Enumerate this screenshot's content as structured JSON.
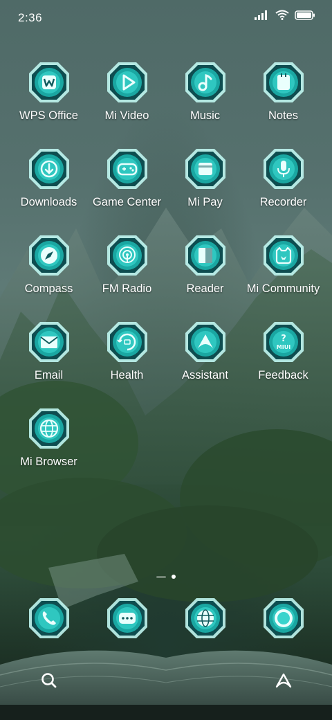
{
  "status_bar": {
    "time": "2:36",
    "icons": [
      "cellular-signal-icon",
      "wifi-icon",
      "battery-icon"
    ]
  },
  "apps": [
    {
      "label": "WPS Office",
      "icon": "wps-office-icon"
    },
    {
      "label": "Mi Video",
      "icon": "play-icon"
    },
    {
      "label": "Music",
      "icon": "music-note-icon"
    },
    {
      "label": "Notes",
      "icon": "notes-icon"
    },
    {
      "label": "Downloads",
      "icon": "download-icon"
    },
    {
      "label": "Game Center",
      "icon": "gamepad-icon"
    },
    {
      "label": "Mi Pay",
      "icon": "wallet-icon"
    },
    {
      "label": "Recorder",
      "icon": "microphone-icon"
    },
    {
      "label": "Compass",
      "icon": "compass-icon"
    },
    {
      "label": "FM Radio",
      "icon": "radio-icon"
    },
    {
      "label": "Reader",
      "icon": "book-icon"
    },
    {
      "label": "Mi Community",
      "icon": "community-icon"
    },
    {
      "label": "Email",
      "icon": "envelope-icon"
    },
    {
      "label": "Health",
      "icon": "health-icon"
    },
    {
      "label": "Assistant",
      "icon": "assistant-icon"
    },
    {
      "label": "Feedback",
      "icon": "feedback-icon",
      "badge_text": "MIUI"
    },
    {
      "label": "Mi Browser",
      "icon": "globe-icon"
    }
  ],
  "dock": [
    {
      "icon": "phone-icon"
    },
    {
      "icon": "messages-icon"
    },
    {
      "icon": "browser-globe-icon"
    },
    {
      "icon": "camera-icon"
    }
  ],
  "page_indicator": {
    "pages": 2,
    "active_index": 1
  },
  "bottom_bar": {
    "left": "search-icon",
    "right": "home-switch-icon"
  },
  "colors": {
    "icon_glow": "#5ee8e0",
    "icon_fill": "#0f5a5c",
    "frame": "#bff5f0"
  }
}
